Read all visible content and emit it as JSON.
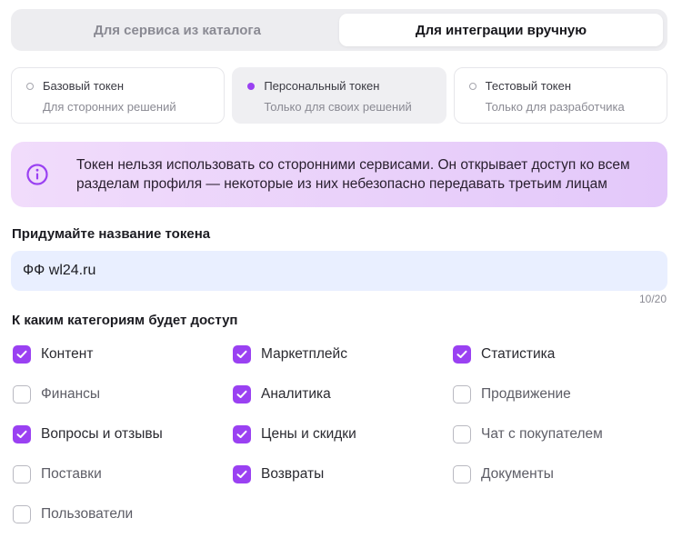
{
  "tabs": [
    {
      "label": "Для сервиса из каталога",
      "active": false
    },
    {
      "label": "Для интеграции вручную",
      "active": true
    }
  ],
  "token_types": [
    {
      "title": "Базовый токен",
      "subtitle": "Для сторонних решений",
      "selected": false
    },
    {
      "title": "Персональный токен",
      "subtitle": "Только для своих решений",
      "selected": true
    },
    {
      "title": "Тестовый токен",
      "subtitle": "Только для разработчика",
      "selected": false
    }
  ],
  "info": {
    "line1": "Токен нельзя использовать со сторонними сервисами. Он открывает доступ ко всем",
    "line2": "разделам профиля — некоторые из них небезопасно передавать третьим лицам",
    "icon": "info-icon"
  },
  "name_field": {
    "label": "Придумайте название токена",
    "value": "ФФ wl24.ru",
    "counter": "10/20"
  },
  "categories": {
    "label": "К каким категориям будет доступ",
    "items": [
      {
        "label": "Контент",
        "checked": true
      },
      {
        "label": "Маркетплейс",
        "checked": true
      },
      {
        "label": "Статистика",
        "checked": true
      },
      {
        "label": "Финансы",
        "checked": false
      },
      {
        "label": "Аналитика",
        "checked": true
      },
      {
        "label": "Продвижение",
        "checked": false
      },
      {
        "label": "Вопросы и отзывы",
        "checked": true
      },
      {
        "label": "Цены и скидки",
        "checked": true
      },
      {
        "label": "Чат с покупателем",
        "checked": false
      },
      {
        "label": "Поставки",
        "checked": false
      },
      {
        "label": "Возвраты",
        "checked": true
      },
      {
        "label": "Документы",
        "checked": false
      },
      {
        "label": "Пользователи",
        "checked": false
      }
    ]
  },
  "colors": {
    "accent": "#9a41f2",
    "input_bg": "#e9efff",
    "info_bg": "#e8d0fa"
  }
}
